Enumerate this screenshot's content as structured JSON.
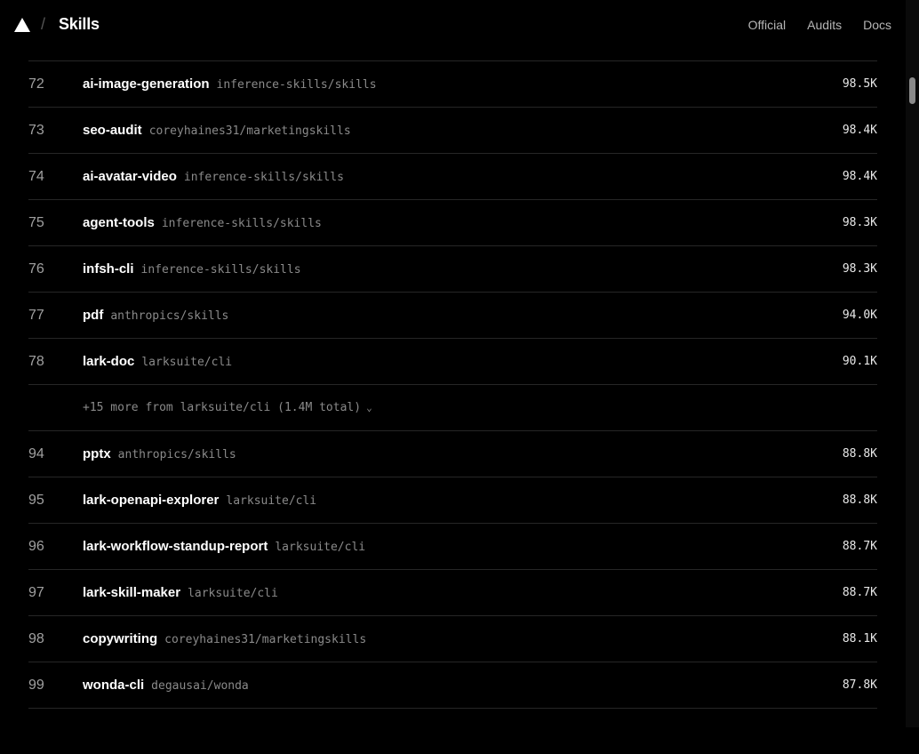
{
  "header": {
    "brand": "Skills",
    "separator": "/",
    "logo_icon": "triangle-logo",
    "nav": [
      {
        "label": "Official"
      },
      {
        "label": "Audits"
      },
      {
        "label": "Docs"
      }
    ]
  },
  "rows": [
    {
      "rank": "72",
      "name": "ai-image-generation",
      "repo": "inference-skills/skills",
      "count": "98.5K"
    },
    {
      "rank": "73",
      "name": "seo-audit",
      "repo": "coreyhaines31/marketingskills",
      "count": "98.4K"
    },
    {
      "rank": "74",
      "name": "ai-avatar-video",
      "repo": "inference-skills/skills",
      "count": "98.4K"
    },
    {
      "rank": "75",
      "name": "agent-tools",
      "repo": "inference-skills/skills",
      "count": "98.3K"
    },
    {
      "rank": "76",
      "name": "infsh-cli",
      "repo": "inference-skills/skills",
      "count": "98.3K"
    },
    {
      "rank": "77",
      "name": "pdf",
      "repo": "anthropics/skills",
      "count": "94.0K"
    },
    {
      "rank": "78",
      "name": "lark-doc",
      "repo": "larksuite/cli",
      "count": "90.1K"
    }
  ],
  "more_row": {
    "label": "+15 more from larksuite/cli (1.4M total)",
    "icon": "chevron-down-icon"
  },
  "rows2": [
    {
      "rank": "94",
      "name": "pptx",
      "repo": "anthropics/skills",
      "count": "88.8K"
    },
    {
      "rank": "95",
      "name": "lark-openapi-explorer",
      "repo": "larksuite/cli",
      "count": "88.8K"
    },
    {
      "rank": "96",
      "name": "lark-workflow-standup-report",
      "repo": "larksuite/cli",
      "count": "88.7K"
    },
    {
      "rank": "97",
      "name": "lark-skill-maker",
      "repo": "larksuite/cli",
      "count": "88.7K"
    },
    {
      "rank": "98",
      "name": "copywriting",
      "repo": "coreyhaines31/marketingskills",
      "count": "88.1K"
    },
    {
      "rank": "99",
      "name": "wonda-cli",
      "repo": "degausai/wonda",
      "count": "87.8K"
    }
  ]
}
